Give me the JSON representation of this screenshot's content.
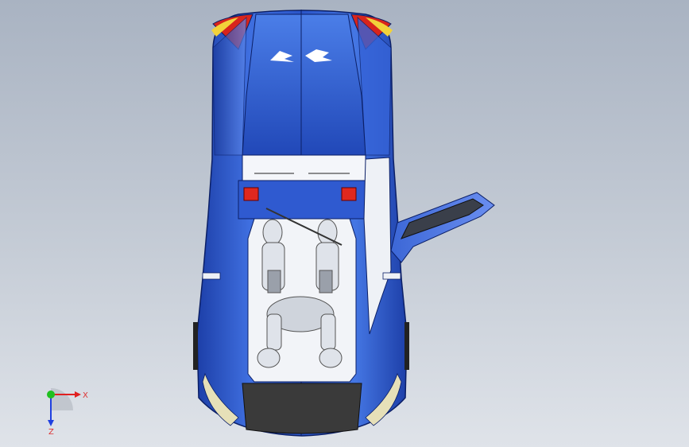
{
  "viewport": {
    "background_top": "#a9b3c2",
    "background_bottom": "#dfe3e9"
  },
  "model": {
    "body_color": "#2a55c8",
    "body_highlight": "#6f96ee",
    "accent_red": "#d8241c",
    "accent_yellow": "#f2d23a",
    "trim_cream": "#e6e0b8",
    "lower_dark": "#3a3a3a",
    "cabin_light": "#f2f4f8",
    "taillight_red": "#e0281e"
  },
  "triad": {
    "x_label": "X",
    "z_label": "Z",
    "x_color": "#e02020",
    "z_color": "#2040e0",
    "y_color": "#20c020"
  }
}
